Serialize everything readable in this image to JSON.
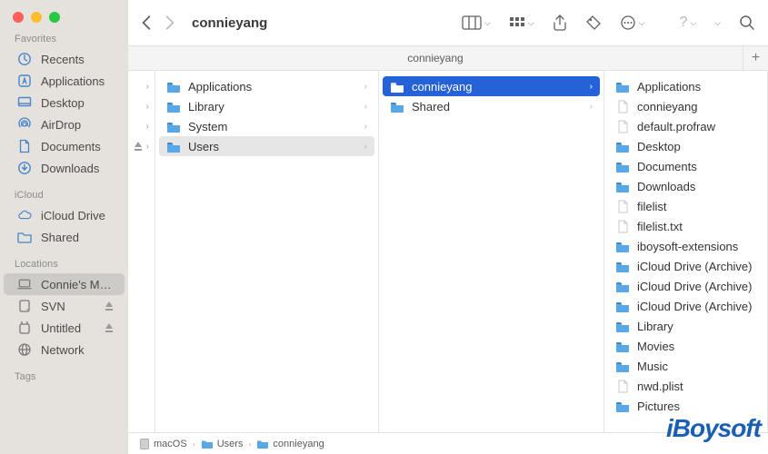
{
  "window": {
    "title": "connieyang"
  },
  "sidebar": {
    "sections": [
      {
        "label": "Favorites",
        "items": [
          {
            "name": "Recents",
            "icon": "clock"
          },
          {
            "name": "Applications",
            "icon": "app"
          },
          {
            "name": "Desktop",
            "icon": "desktop"
          },
          {
            "name": "AirDrop",
            "icon": "airdrop"
          },
          {
            "name": "Documents",
            "icon": "doc"
          },
          {
            "name": "Downloads",
            "icon": "download"
          }
        ]
      },
      {
        "label": "iCloud",
        "items": [
          {
            "name": "iCloud Drive",
            "icon": "cloud"
          },
          {
            "name": "Shared",
            "icon": "shared"
          }
        ]
      },
      {
        "label": "Locations",
        "items": [
          {
            "name": "Connie's Ma…",
            "icon": "laptop",
            "selected": true
          },
          {
            "name": "SVN",
            "icon": "disk",
            "eject": true
          },
          {
            "name": "Untitled",
            "icon": "disk-ext",
            "eject": true
          },
          {
            "name": "Network",
            "icon": "network"
          }
        ]
      },
      {
        "label": "Tags",
        "items": []
      }
    ]
  },
  "columns": {
    "c0": [
      {
        "name": "",
        "chev": true
      },
      {
        "name": "",
        "chev": true
      },
      {
        "name": "",
        "chev": true
      },
      {
        "name": "",
        "chev": true,
        "eject": true
      }
    ],
    "c1": [
      {
        "name": "Applications",
        "icon": "folder",
        "chev": true
      },
      {
        "name": "Library",
        "icon": "folder",
        "chev": true
      },
      {
        "name": "System",
        "icon": "folder",
        "chev": true
      },
      {
        "name": "Users",
        "icon": "folder",
        "chev": true,
        "selected": "gray"
      }
    ],
    "c2": [
      {
        "name": "connieyang",
        "icon": "folder",
        "chev": true,
        "selected": "blue"
      },
      {
        "name": "Shared",
        "icon": "folder",
        "chev": true
      }
    ],
    "c3": [
      {
        "name": "Applications",
        "icon": "folder"
      },
      {
        "name": "connieyang",
        "icon": "file"
      },
      {
        "name": "default.profraw",
        "icon": "file"
      },
      {
        "name": "Desktop",
        "icon": "folder"
      },
      {
        "name": "Documents",
        "icon": "folder"
      },
      {
        "name": "Downloads",
        "icon": "folder"
      },
      {
        "name": "filelist",
        "icon": "file"
      },
      {
        "name": "filelist.txt",
        "icon": "file"
      },
      {
        "name": "iboysoft-extensions",
        "icon": "folder"
      },
      {
        "name": "iCloud Drive (Archive)",
        "icon": "folder"
      },
      {
        "name": "iCloud Drive (Archive)",
        "icon": "folder"
      },
      {
        "name": "iCloud Drive (Archive)",
        "icon": "folder"
      },
      {
        "name": "Library",
        "icon": "folder"
      },
      {
        "name": "Movies",
        "icon": "folder"
      },
      {
        "name": "Music",
        "icon": "folder"
      },
      {
        "name": "nwd.plist",
        "icon": "file"
      },
      {
        "name": "Pictures",
        "icon": "folder"
      }
    ]
  },
  "tabbar": {
    "tab": "connieyang"
  },
  "pathbar": [
    {
      "name": "macOS",
      "icon": "disk"
    },
    {
      "name": "Users",
      "icon": "folder"
    },
    {
      "name": "connieyang",
      "icon": "folder"
    }
  ],
  "watermark": "iBoysoft"
}
